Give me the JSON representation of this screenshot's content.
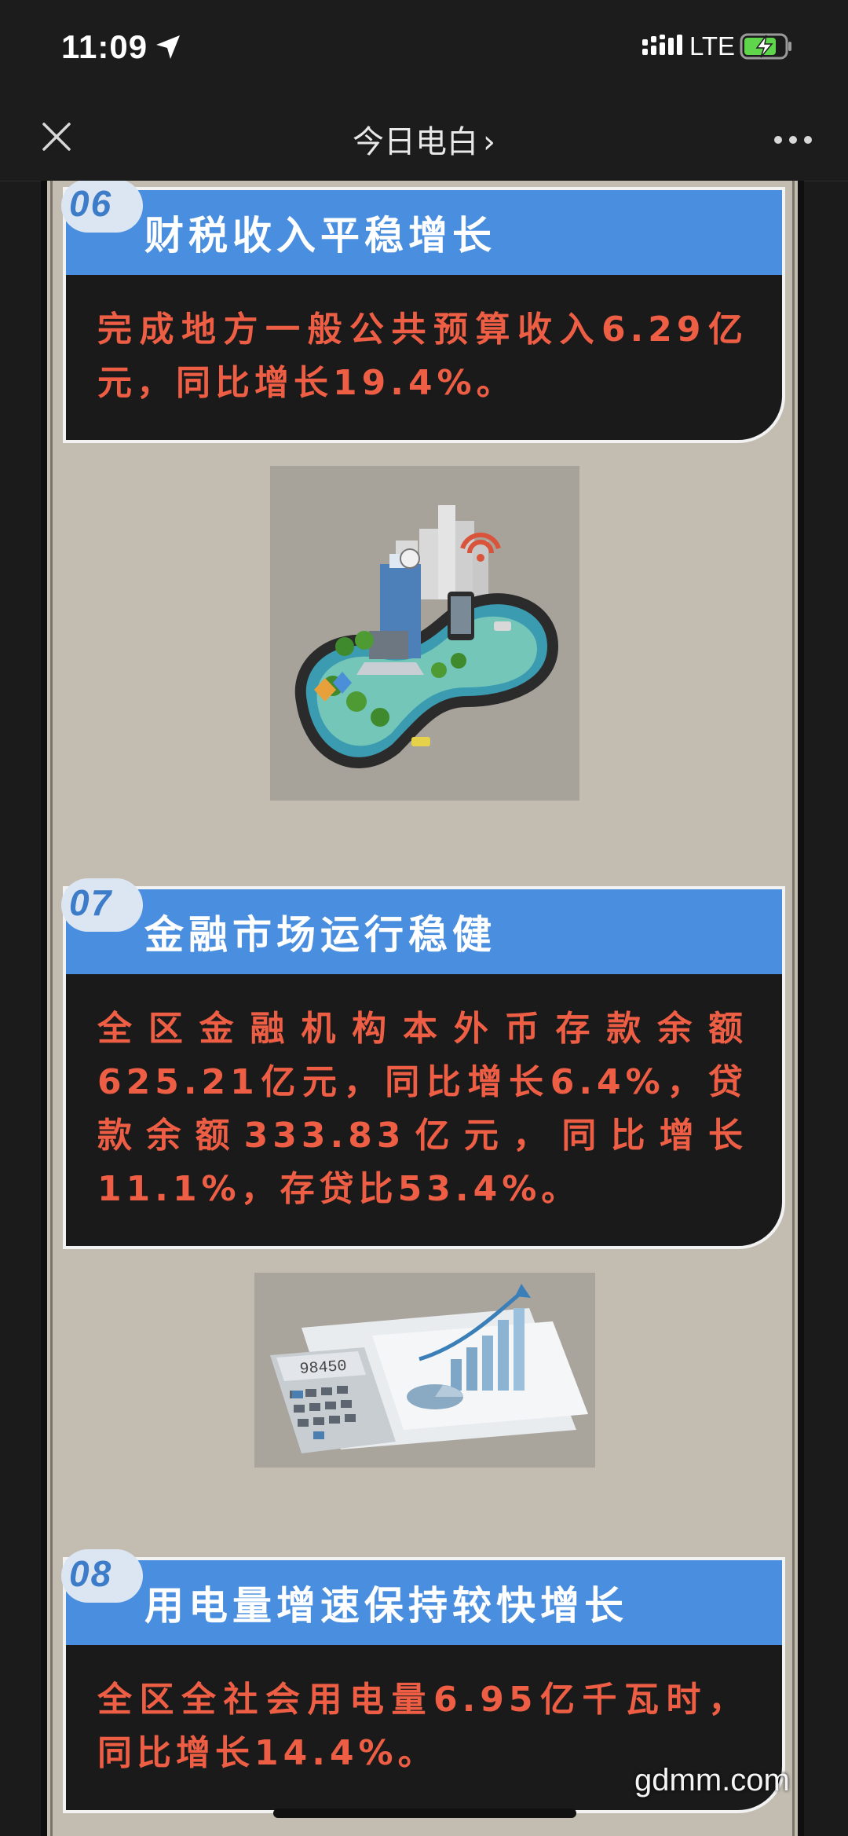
{
  "status_bar": {
    "time": "11:09",
    "network": "LTE"
  },
  "nav": {
    "title": "今日电白",
    "chevron": "›"
  },
  "sections": [
    {
      "number": "06",
      "title": "财税收入平稳增长",
      "body": "完成地方一般公共预算收入6.29亿元，同比增长19.4%。"
    },
    {
      "number": "07",
      "title": "金融市场运行稳健",
      "body": "全区金融机构本外币存款余额625.21亿元，同比增长6.4%，贷款余额333.83亿元，同比增长11.1%，存贷比53.4%。"
    },
    {
      "number": "08",
      "title": "用电量增速保持较快增长",
      "body": "全区全社会用电量6.95亿千瓦时，同比增长14.4%。"
    }
  ],
  "calculator_display": "98450",
  "watermark": "gdmm.com",
  "colors": {
    "header_blue": "#4a8fdf",
    "body_red": "#ee5e45",
    "card_bg": "#1a1a1a",
    "page_bg": "#c2bcb1"
  }
}
